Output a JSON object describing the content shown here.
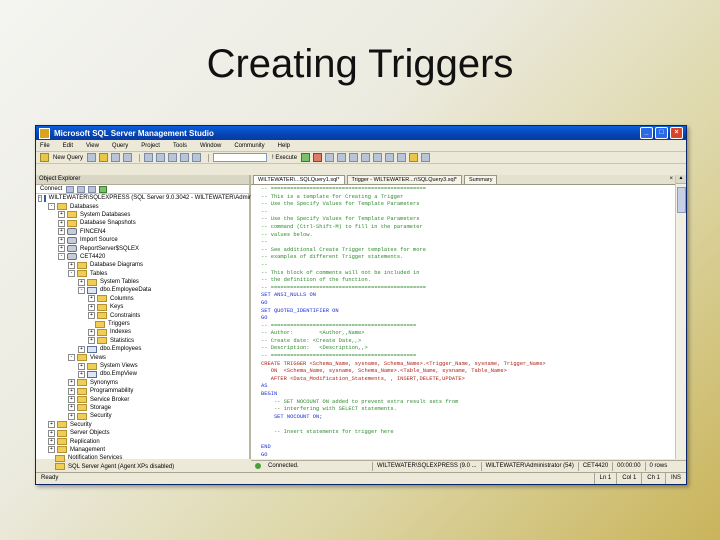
{
  "slide": {
    "title": "Creating Triggers"
  },
  "window": {
    "title": "Microsoft SQL Server Management Studio",
    "controls": {
      "minimize": "_",
      "maximize": "□",
      "close": "×"
    }
  },
  "menu": [
    "File",
    "Edit",
    "View",
    "Query",
    "Project",
    "Tools",
    "Window",
    "Community",
    "Help"
  ],
  "toolbar": {
    "new_query": "New Query",
    "execute": "! Execute"
  },
  "explorer": {
    "title": "Object Explorer",
    "connect": "Connect",
    "tree": [
      {
        "label": "WILTEWATER\\SQLEXPRESS (SQL Server 9.0.3042 - WILTEWATER\\Administrator)",
        "depth": 0,
        "exp": "-",
        "icon": "server"
      },
      {
        "label": "Databases",
        "depth": 1,
        "exp": "-",
        "icon": "folder"
      },
      {
        "label": "System Databases",
        "depth": 2,
        "exp": "+",
        "icon": "folder"
      },
      {
        "label": "Database Snapshots",
        "depth": 2,
        "exp": "+",
        "icon": "folder"
      },
      {
        "label": "FINCEN4",
        "depth": 2,
        "exp": "+",
        "icon": "db"
      },
      {
        "label": "Import Source",
        "depth": 2,
        "exp": "+",
        "icon": "db"
      },
      {
        "label": "ReportServer$SQLEX",
        "depth": 2,
        "exp": "+",
        "icon": "db"
      },
      {
        "label": "CET4420",
        "depth": 2,
        "exp": "-",
        "icon": "db"
      },
      {
        "label": "Database Diagrams",
        "depth": 3,
        "exp": "+",
        "icon": "folder"
      },
      {
        "label": "Tables",
        "depth": 3,
        "exp": "-",
        "icon": "folder"
      },
      {
        "label": "System Tables",
        "depth": 4,
        "exp": "+",
        "icon": "folder"
      },
      {
        "label": "dbo.EmployeeData",
        "depth": 4,
        "exp": "-",
        "icon": "table"
      },
      {
        "label": "Columns",
        "depth": 5,
        "exp": "+",
        "icon": "folder"
      },
      {
        "label": "Keys",
        "depth": 5,
        "exp": "+",
        "icon": "folder"
      },
      {
        "label": "Constraints",
        "depth": 5,
        "exp": "+",
        "icon": "folder"
      },
      {
        "label": "Triggers",
        "depth": 5,
        "exp": "",
        "icon": "folder"
      },
      {
        "label": "Indexes",
        "depth": 5,
        "exp": "+",
        "icon": "folder"
      },
      {
        "label": "Statistics",
        "depth": 5,
        "exp": "+",
        "icon": "folder"
      },
      {
        "label": "dbo.Employees",
        "depth": 4,
        "exp": "+",
        "icon": "table"
      },
      {
        "label": "Views",
        "depth": 3,
        "exp": "-",
        "icon": "folder"
      },
      {
        "label": "System Views",
        "depth": 4,
        "exp": "+",
        "icon": "folder"
      },
      {
        "label": "dbo.EmpView",
        "depth": 4,
        "exp": "+",
        "icon": "table"
      },
      {
        "label": "Synonyms",
        "depth": 3,
        "exp": "+",
        "icon": "folder"
      },
      {
        "label": "Programmability",
        "depth": 3,
        "exp": "+",
        "icon": "folder"
      },
      {
        "label": "Service Broker",
        "depth": 3,
        "exp": "+",
        "icon": "folder"
      },
      {
        "label": "Storage",
        "depth": 3,
        "exp": "+",
        "icon": "folder"
      },
      {
        "label": "Security",
        "depth": 3,
        "exp": "+",
        "icon": "folder"
      },
      {
        "label": "Security",
        "depth": 1,
        "exp": "+",
        "icon": "folder"
      },
      {
        "label": "Server Objects",
        "depth": 1,
        "exp": "+",
        "icon": "folder"
      },
      {
        "label": "Replication",
        "depth": 1,
        "exp": "+",
        "icon": "folder"
      },
      {
        "label": "Management",
        "depth": 1,
        "exp": "+",
        "icon": "folder"
      },
      {
        "label": "Notification Services",
        "depth": 1,
        "exp": "",
        "icon": "folder"
      },
      {
        "label": "SQL Server Agent (Agent XPs disabled)",
        "depth": 1,
        "exp": "",
        "icon": "folder"
      }
    ]
  },
  "editor": {
    "tabs": [
      {
        "label": "WILTEWATER\\...SQLQuery1.sql*",
        "active": true
      },
      {
        "label": "Trigger - WILTEWATER...r\\SQLQuery3.sql*",
        "active": false
      },
      {
        "label": "Summary",
        "active": false
      }
    ],
    "close": "×",
    "lines": [
      {
        "t": "-- ================================================",
        "c": "c-comment"
      },
      {
        "t": "-- This is a template for Creating a Trigger",
        "c": "c-comment"
      },
      {
        "t": "-- Use the Specify Values for Template Parameters",
        "c": "c-comment"
      },
      {
        "t": "-- ",
        "c": "c-comment"
      },
      {
        "t": "-- Use the Specify Values for Template Parameters",
        "c": "c-comment"
      },
      {
        "t": "-- command (Ctrl-Shift-M) to fill in the parameter",
        "c": "c-comment"
      },
      {
        "t": "-- values below.",
        "c": "c-comment"
      },
      {
        "t": "--",
        "c": "c-comment"
      },
      {
        "t": "-- See additional Create Trigger templates for more",
        "c": "c-comment"
      },
      {
        "t": "-- examples of different Trigger statements.",
        "c": "c-comment"
      },
      {
        "t": "--",
        "c": "c-comment"
      },
      {
        "t": "-- This block of comments will not be included in",
        "c": "c-comment"
      },
      {
        "t": "-- the definition of the function.",
        "c": "c-comment"
      },
      {
        "t": "-- ================================================",
        "c": "c-comment"
      },
      {
        "t": "SET ANSI_NULLS ON",
        "c": "c-kw"
      },
      {
        "t": "GO",
        "c": "c-kw"
      },
      {
        "t": "SET QUOTED_IDENTIFIER ON",
        "c": "c-kw"
      },
      {
        "t": "GO",
        "c": "c-kw"
      },
      {
        "t": "-- =============================================",
        "c": "c-comment"
      },
      {
        "t": "-- Author:        <Author,,Name>",
        "c": "c-comment"
      },
      {
        "t": "-- Create date: <Create Date,,>",
        "c": "c-comment"
      },
      {
        "t": "-- Description:   <Description,,>",
        "c": "c-comment"
      },
      {
        "t": "-- =============================================",
        "c": "c-comment"
      },
      {
        "t": "CREATE TRIGGER <Schema_Name, sysname, Schema_Name>.<Trigger_Name, sysname, Trigger_Name>",
        "c": "c-red"
      },
      {
        "t": "   ON  <Schema_Name, sysname, Schema_Name>.<Table_Name, sysname, Table_Name>",
        "c": "c-red"
      },
      {
        "t": "   AFTER <Data_Modification_Statements, , INSERT,DELETE,UPDATE>",
        "c": "c-red"
      },
      {
        "t": "AS",
        "c": "c-kw"
      },
      {
        "t": "BEGIN",
        "c": "c-kw"
      },
      {
        "t": "    -- SET NOCOUNT ON added to prevent extra result sets from",
        "c": "c-comment"
      },
      {
        "t": "    -- interfering with SELECT statements.",
        "c": "c-comment"
      },
      {
        "t": "    SET NOCOUNT ON;",
        "c": "c-kw"
      },
      {
        "t": "",
        "c": "c-plain"
      },
      {
        "t": "    -- Insert statements for trigger here",
        "c": "c-comment"
      },
      {
        "t": "",
        "c": "c-plain"
      },
      {
        "t": "END",
        "c": "c-kw"
      },
      {
        "t": "GO",
        "c": "c-kw"
      }
    ]
  },
  "editor_status": {
    "connected": "Connected.",
    "server": "WILTEWATER\\SQLEXPRESS (9.0 ...",
    "user": "WILTEWATER\\Administrator (54)",
    "database": "CET4420",
    "time": "00:00:00",
    "rows": "0 rows"
  },
  "app_status": {
    "ready": "Ready",
    "ln": "Ln 1",
    "col": "Col 1",
    "ch": "Ch 1",
    "mode": "INS"
  }
}
